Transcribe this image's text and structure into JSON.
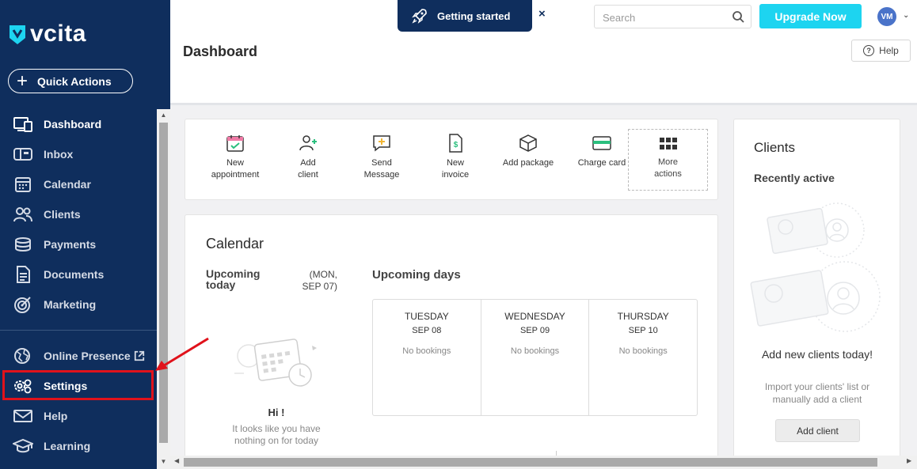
{
  "brand": {
    "name": "vcita",
    "accent": "#1dd4f0",
    "sidebar_bg": "#0f2e5d"
  },
  "sidebar": {
    "quick_actions": "Quick Actions",
    "items": [
      {
        "label": "Dashboard",
        "icon": "dashboard-icon"
      },
      {
        "label": "Inbox",
        "icon": "inbox-icon"
      },
      {
        "label": "Calendar",
        "icon": "calendar-icon"
      },
      {
        "label": "Clients",
        "icon": "clients-icon"
      },
      {
        "label": "Payments",
        "icon": "payments-icon"
      },
      {
        "label": "Documents",
        "icon": "documents-icon"
      },
      {
        "label": "Marketing",
        "icon": "marketing-icon"
      }
    ],
    "bottom_items": [
      {
        "label": "Online Presence",
        "icon": "globe-icon"
      },
      {
        "label": "Settings",
        "icon": "settings-icon"
      },
      {
        "label": "Help",
        "icon": "mail-icon"
      },
      {
        "label": "Learning",
        "icon": "graduation-cap-icon"
      }
    ]
  },
  "topbar": {
    "getting_started": "Getting started",
    "close": "×",
    "search_placeholder": "Search",
    "upgrade": "Upgrade Now",
    "avatar_initials": "VM"
  },
  "header": {
    "title": "Dashboard",
    "help": "Help"
  },
  "quick_actions": [
    {
      "line1": "New",
      "line2": "appointment",
      "icon": "calendar-check-icon"
    },
    {
      "line1": "Add",
      "line2": "client",
      "icon": "add-user-icon"
    },
    {
      "line1": "Send",
      "line2": "Message",
      "icon": "message-icon"
    },
    {
      "line1": "New",
      "line2": "invoice",
      "icon": "invoice-icon"
    },
    {
      "line1": "Add package",
      "line2": "",
      "icon": "package-icon"
    },
    {
      "line1": "Charge card",
      "line2": "",
      "icon": "credit-card-icon"
    }
  ],
  "more_actions": {
    "line1": "More",
    "line2": "actions"
  },
  "calendar": {
    "title": "Calendar",
    "upcoming_today": "Upcoming today",
    "today_date": "(MON, SEP 07)",
    "upcoming_days": "Upcoming days",
    "days": [
      {
        "name": "TUESDAY",
        "date": "SEP 08",
        "status": "No bookings"
      },
      {
        "name": "WEDNESDAY",
        "date": "SEP 09",
        "status": "No bookings"
      },
      {
        "name": "THURSDAY",
        "date": "SEP 10",
        "status": "No bookings"
      }
    ],
    "empty_title": "Hi !",
    "empty_text": "It looks like you have nothing on for today"
  },
  "clients": {
    "title": "Clients",
    "recently_active": "Recently active",
    "add_title": "Add new clients today!",
    "add_text": "Import your clients' list or manually add a client",
    "add_button": "Add client"
  }
}
